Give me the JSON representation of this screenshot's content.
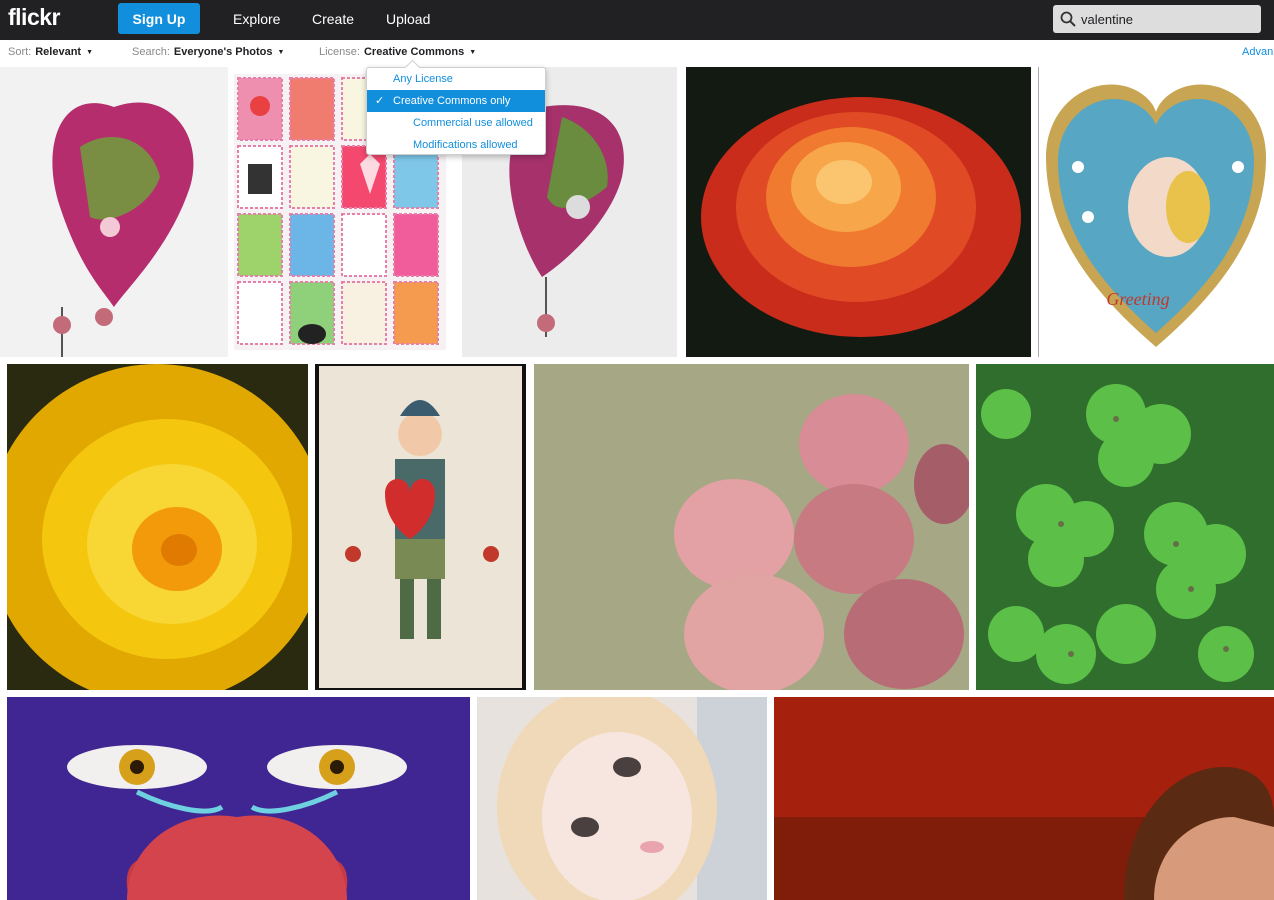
{
  "header": {
    "logo": "flickr",
    "signup_label": "Sign Up",
    "nav": [
      "Explore",
      "Create",
      "Upload"
    ],
    "search_value": "valentine",
    "search_icon": "search-icon"
  },
  "filters": {
    "sort_label": "Sort:",
    "sort_value": "Relevant",
    "search_label": "Search:",
    "search_value": "Everyone's Photos",
    "license_label": "License:",
    "license_value": "Creative Commons",
    "advanced_label": "Advan"
  },
  "license_menu": {
    "items": [
      "Any License",
      "Creative Commons only",
      "Commercial use allowed",
      "Modifications allowed"
    ],
    "selected_index": 1
  },
  "colors": {
    "topbar": "#212124",
    "accent": "#128fdc"
  }
}
